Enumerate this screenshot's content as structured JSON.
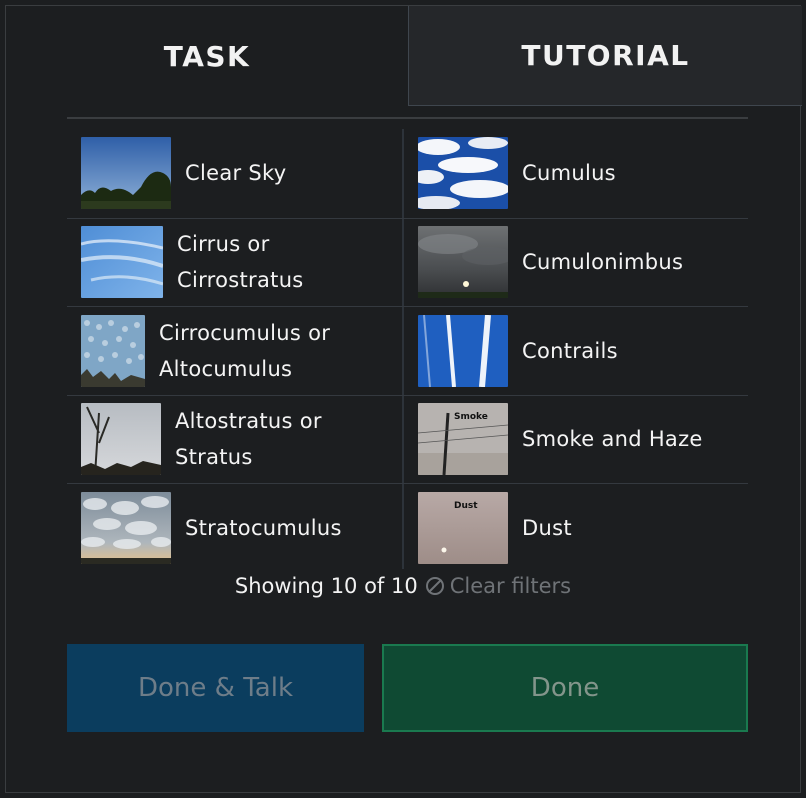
{
  "tabs": {
    "task": "TASK",
    "tutorial": "TUTORIAL"
  },
  "choices": [
    {
      "label_lines": [
        "Clear Sky"
      ],
      "icon": "clear-sky-thumbnail"
    },
    {
      "label_lines": [
        "Cumulus"
      ],
      "icon": "cumulus-thumbnail"
    },
    {
      "label_lines": [
        "Cirrus or",
        "Cirrostratus"
      ],
      "icon": "cirrus-thumbnail"
    },
    {
      "label_lines": [
        "Cumulonimbus"
      ],
      "icon": "cumulonimbus-thumbnail"
    },
    {
      "label_lines": [
        "Cirrocumulus or",
        "Altocumulus"
      ],
      "icon": "cirrocumulus-thumbnail"
    },
    {
      "label_lines": [
        "Contrails"
      ],
      "icon": "contrails-thumbnail"
    },
    {
      "label_lines": [
        "Altostratus or",
        "Stratus"
      ],
      "icon": "altostratus-thumbnail"
    },
    {
      "label_lines": [
        "Smoke and Haze"
      ],
      "icon": "smoke-thumbnail",
      "thumb_text": "Smoke"
    },
    {
      "label_lines": [
        "Stratocumulus"
      ],
      "icon": "stratocumulus-thumbnail"
    },
    {
      "label_lines": [
        "Dust"
      ],
      "icon": "dust-thumbnail",
      "thumb_text": "Dust"
    }
  ],
  "filter_status": {
    "count_text": "Showing 10 of 10",
    "clear_label": "Clear filters",
    "clear_icon": "ban-icon"
  },
  "actions": {
    "done_talk": "Done & Talk",
    "done": "Done"
  },
  "colors": {
    "background": "#1c1e20",
    "tutorial_tab": "#25272a",
    "done_talk_bg": "#0b3d5e",
    "done_bg": "#0f4a33",
    "done_border": "#1a7a4f"
  }
}
